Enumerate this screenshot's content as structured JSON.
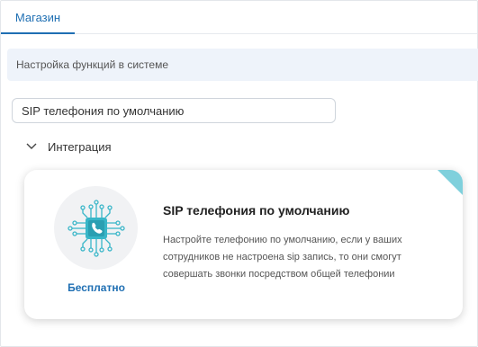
{
  "tabs": [
    {
      "label": "Магазин",
      "active": true
    }
  ],
  "banner": {
    "text": "Настройка функций в системе"
  },
  "search": {
    "value": "SIP телефония по умолчанию"
  },
  "group": {
    "label": "Интеграция",
    "expanded": true
  },
  "card": {
    "title": "SIP телефония по умолчанию",
    "description": "Настройте телефонию по умолчанию, если у ваших сотрудников не настроена sip запись, то они смогут совершать звонки посредством общей телефонии",
    "price": "Бесплатно",
    "icon": "sip-chip-phone-icon",
    "accent_color": "#38b6c8",
    "corner_color": "#7fd0dc"
  },
  "colors": {
    "primary": "#1f6fb3",
    "banner_bg": "#eef3fa"
  }
}
